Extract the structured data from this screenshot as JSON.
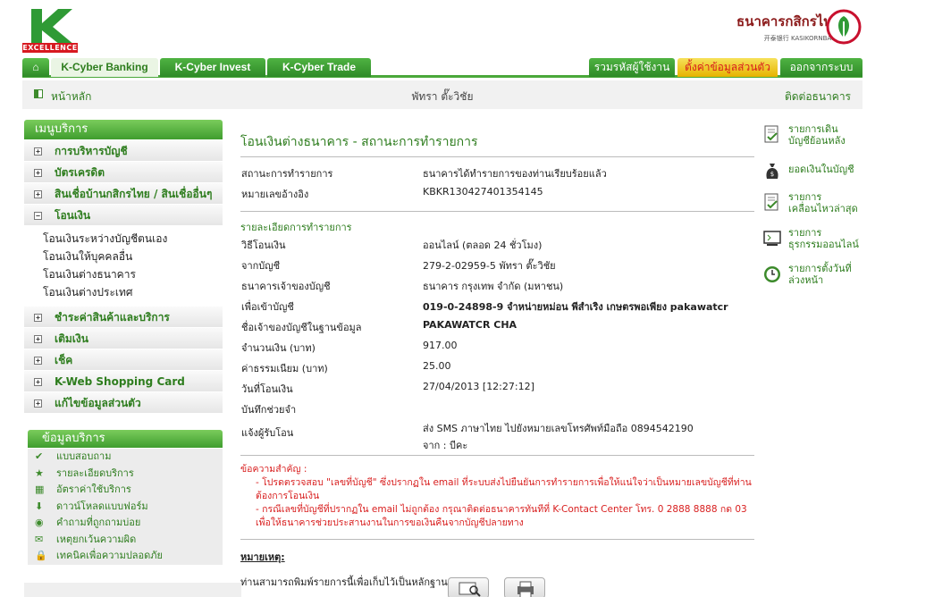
{
  "header": {
    "logo_text": "EXCELLENCE",
    "bank_name_th": "ธนาคารกสิกรไทย",
    "bank_name_en": "开泰银行 KASIKORNBANK"
  },
  "tabs": {
    "home": "⌂",
    "active": "K-Cyber Banking",
    "invest": "K-Cyber Invest",
    "trade": "K-Cyber Trade",
    "change_password": "รวมรหัสผู้ใช้งาน",
    "profile": "ตั้งค่าข้อมูลส่วนตัว",
    "logout": "ออกจากระบบ"
  },
  "subbar": {
    "home_link": "หน้าหลัก",
    "user_name": "พัทรา ตั๊ะวิชัย",
    "contact": "ติดต่อธนาคาร"
  },
  "sidebar": {
    "title": "เมนูบริการ",
    "items": [
      {
        "label": "การบริหารบัญชี",
        "toggle": "+"
      },
      {
        "label": "บัตรเครดิต",
        "toggle": "+"
      },
      {
        "label": "สินเชื่อบ้านกสิกรไทย / สินเชื่ออื่นๆ",
        "toggle": "+"
      },
      {
        "label": "โอนเงิน",
        "toggle": "−"
      },
      {
        "label": "ชำระค่าสินค้าและบริการ",
        "toggle": "+"
      },
      {
        "label": "เติมเงิน",
        "toggle": "+"
      },
      {
        "label": "เช็ค",
        "toggle": "+"
      },
      {
        "label": "K-Web Shopping Card",
        "toggle": "+"
      },
      {
        "label": "แก้ไขข้อมูลส่วนตัว",
        "toggle": "+"
      }
    ],
    "transfer_sub": [
      "โอนเงินระหว่างบัญชีตนเอง",
      "โอนเงินให้บุคคลอื่น",
      "โอนเงินต่างธนาคาร",
      "โอนเงินต่างประเทศ"
    ],
    "info_title": "ข้อมูลบริการ",
    "info_items": [
      {
        "label": "แบบสอบถาม",
        "icon": "✔"
      },
      {
        "label": "รายละเอียดบริการ",
        "icon": "★"
      },
      {
        "label": "อัตราค่าใช้บริการ",
        "icon": "▦"
      },
      {
        "label": "ดาวน์โหลดแบบฟอร์ม",
        "icon": "⬇"
      },
      {
        "label": "คำถามที่ถูกถามบ่อย",
        "icon": "◉"
      },
      {
        "label": "เหตุยกเว้นความผิด",
        "icon": "✉"
      },
      {
        "label": "เทคนิคเพื่อความปลอดภัย",
        "icon": "🔒"
      }
    ]
  },
  "main": {
    "title": "โอนเงินต่างธนาคาร - สถานะการทำรายการ",
    "status_rows": [
      {
        "k": "สถานะการทำรายการ",
        "v": "ธนาคารได้ทำรายการของท่านเรียบร้อยแล้ว"
      },
      {
        "k": "หมายเลขอ้างอิง",
        "v": "KBKR130427401354145"
      }
    ],
    "section_title": "รายละเอียดการทำรายการ",
    "detail_rows": [
      {
        "k": "วิธีโอนเงิน",
        "v": "ออนไลน์ (ตลอด 24 ชั่วโมง)",
        "bold": false
      },
      {
        "k": "จากบัญชี",
        "v": "279-2-02959-5 พัทรา ตั๊ะวิชัย",
        "bold": false
      },
      {
        "k": "ธนาคารเจ้าของบัญชี",
        "v": "ธนาคาร กรุงเทพ จำกัด (มหาชน)",
        "bold": false
      },
      {
        "k": "เพื่อเข้าบัญชี",
        "v": "019-0-24898-9 จำหน่ายหม่อน พีสำเริง เกษตรพอเพียง pakawatcr",
        "bold": true
      },
      {
        "k": "ชื่อเจ้าของบัญชีในฐานข้อมูล",
        "v": "PAKAWATCR CHA",
        "bold": true
      },
      {
        "k": "จำนวนเงิน (บาท)",
        "v": "917.00",
        "bold": false
      },
      {
        "k": "ค่าธรรมเนียม (บาท)",
        "v": "25.00",
        "bold": false
      },
      {
        "k": "วันที่โอนเงิน",
        "v": "27/04/2013 [12:27:12]",
        "bold": false
      },
      {
        "k": "บันทึกช่วยจำ",
        "v": "",
        "bold": false
      }
    ],
    "notify_label": "แจ้งผู้รับโอน",
    "notify_line1": "ส่ง SMS ภาษาไทย ไปยังหมายเลขโทรศัพท์มือถือ 0894542190",
    "notify_line2": "จาก : บีคะ",
    "note_title": "ข้อความสำคัญ :",
    "note_1": "- โปรดตรวจสอบ \"เลขที่บัญชี\" ซึ่งปรากฏใน email ที่ระบบส่งไปยืนยันการทำรายการเพื่อให้แน่ใจว่าเป็นหมายเลขบัญชีที่ท่านต้องการโอนเงิน",
    "note_2": "- กรณีเลขที่บัญชีที่ปรากฏใน email ไม่ถูกต้อง กรุณาติดต่อธนาคารทันทีที่ K-Contact Center โทร. 0 2888 8888 กด 03 เพื่อให้ธนาคารช่วยประสานงานในการขอเงินคืนจากบัญชีปลายทาง",
    "remark_title": "หมายเหตุ:",
    "remark_text": "ท่านสามารถพิมพ์รายการนี้เพื่อเก็บไว้เป็นหลักฐาน"
  },
  "right_panel": [
    {
      "line1": "รายการเดิน",
      "line2": "บัญชีย้อนหลัง",
      "icon": "document-check-icon"
    },
    {
      "line1": "ยอดเงินในบัญชี",
      "line2": "",
      "icon": "money-bag-icon"
    },
    {
      "line1": "รายการ",
      "line2": "เคลื่อนไหวล่าสุด",
      "icon": "document-check-icon"
    },
    {
      "line1": "รายการ",
      "line2": "ธุรกรรมออนไลน์",
      "icon": "monitor-icon"
    },
    {
      "line1": "รายการตั้งวันที่",
      "line2": "ล่วงหน้า",
      "icon": "clock-icon"
    }
  ]
}
